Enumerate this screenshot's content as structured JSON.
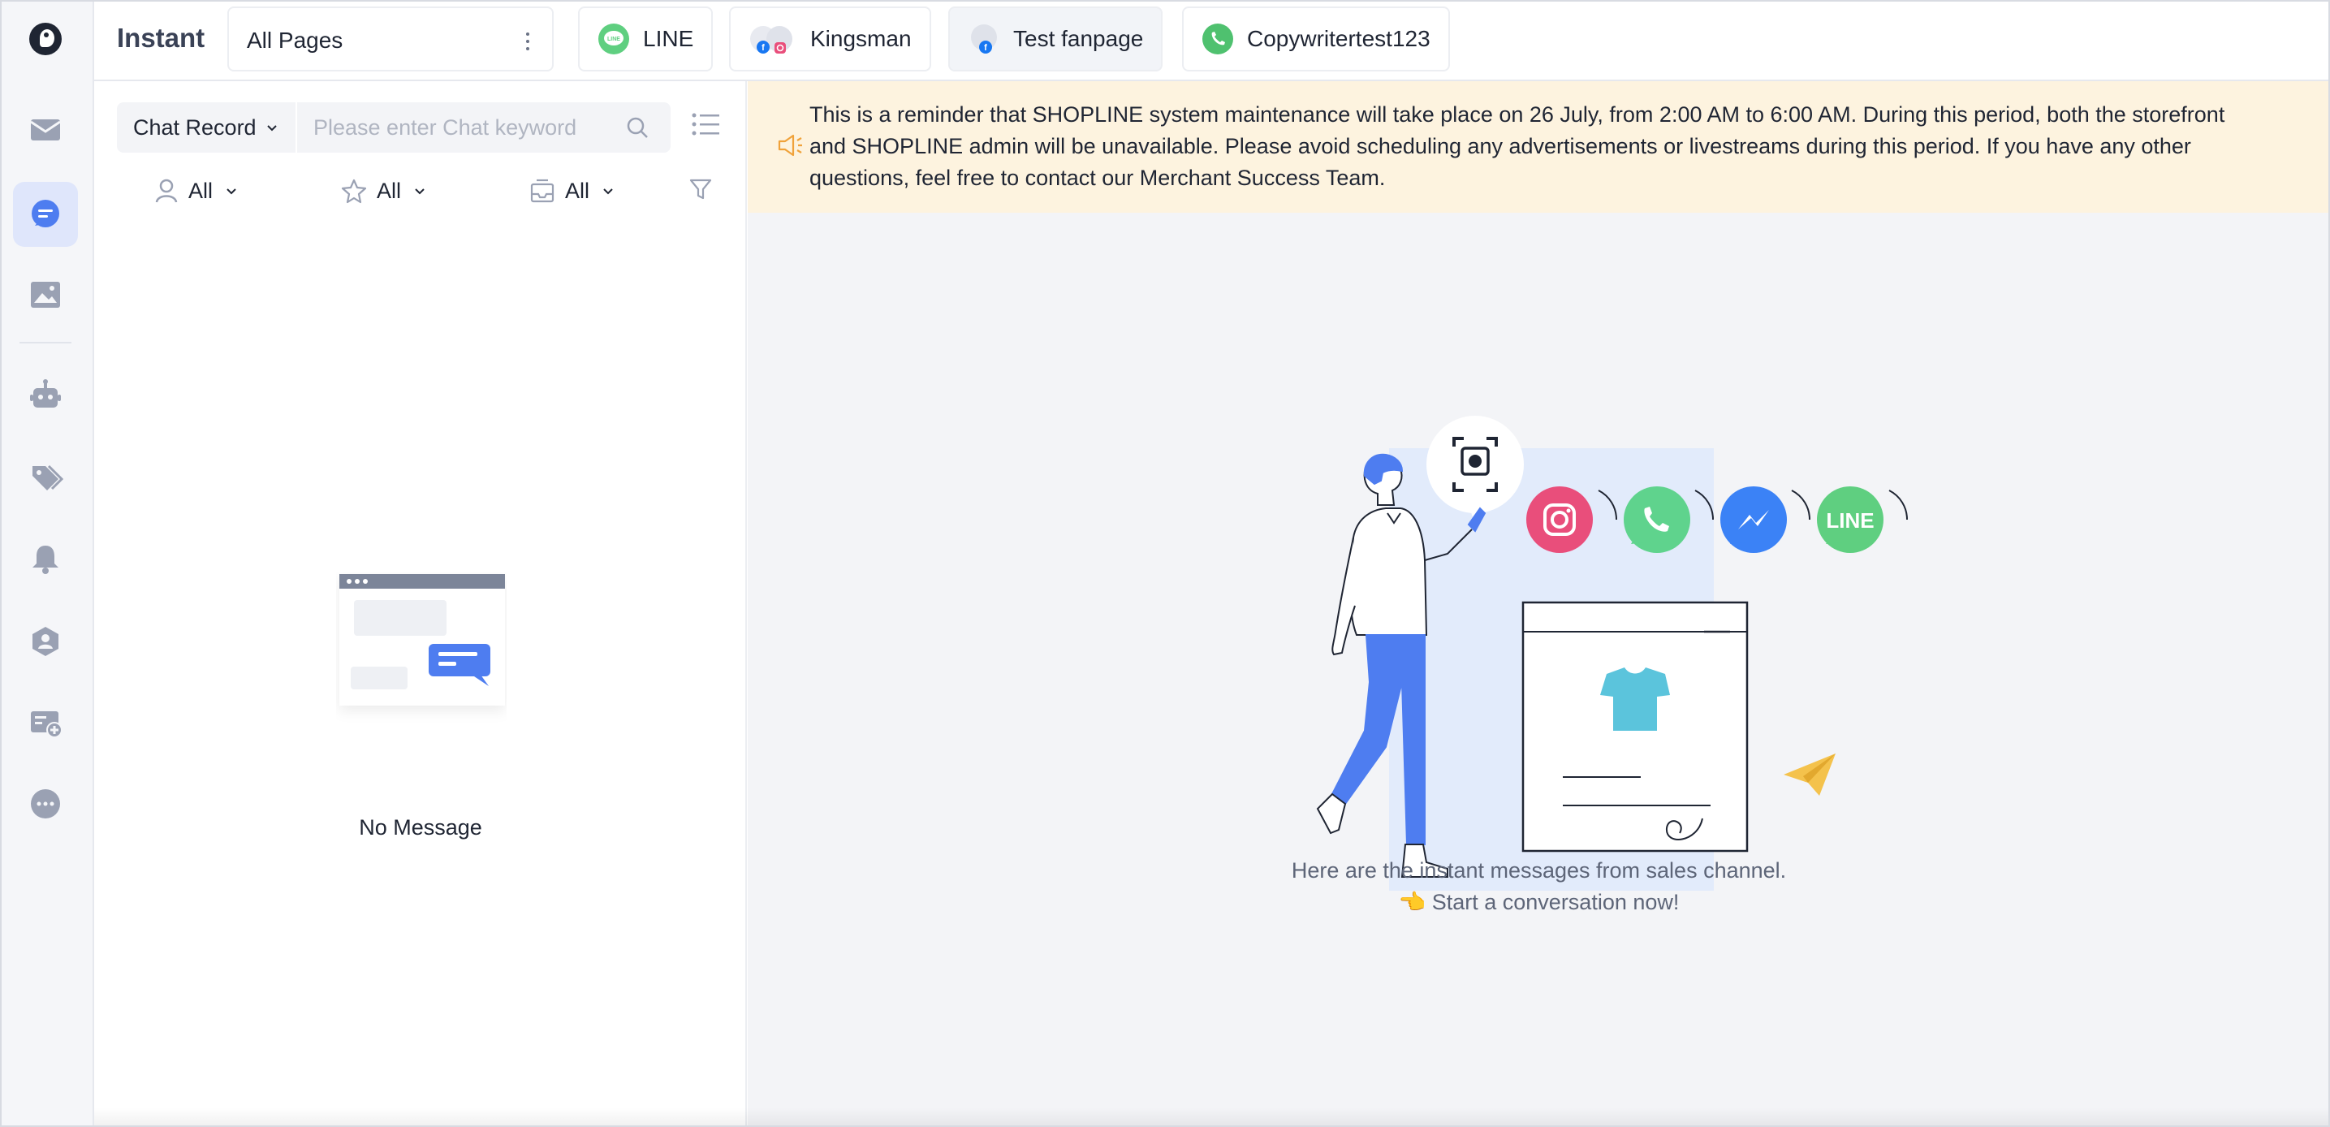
{
  "app": {
    "title": "Instant"
  },
  "page_selector": {
    "label": "All Pages"
  },
  "channel_tabs": [
    {
      "label": "LINE",
      "icon": "line-icon"
    },
    {
      "label": "Kingsman",
      "icon": "facebook-instagram-avatar-icon"
    },
    {
      "label": "Test fanpage",
      "icon": "facebook-avatar-icon"
    },
    {
      "label": "Copywritertest123",
      "icon": "whatsapp-icon"
    }
  ],
  "sidebar": {
    "items": [
      {
        "name": "inbox-icon"
      },
      {
        "name": "chat-icon",
        "active": true
      },
      {
        "name": "image-icon"
      },
      {
        "name": "bot-icon"
      },
      {
        "name": "tags-icon"
      },
      {
        "name": "bell-icon"
      },
      {
        "name": "team-icon"
      },
      {
        "name": "broadcast-icon"
      },
      {
        "name": "more-icon"
      }
    ]
  },
  "search": {
    "scope_label": "Chat Record",
    "placeholder": "Please enter Chat keyword"
  },
  "filters": {
    "assignee": "All",
    "star": "All",
    "inbox": "All"
  },
  "empty_state": {
    "text": "No Message"
  },
  "banner": {
    "text": "This is a reminder that SHOPLINE system maintenance will take place on 26 July, from 2:00 AM to 6:00 AM. During this period, both the storefront and SHOPLINE admin will be unavailable. Please avoid scheduling any advertisements or livestreams during this period. If you have any other questions, feel free to contact our Merchant Success Team."
  },
  "hero": {
    "line1": "Here are the instant messages from sales channel.",
    "line2": "👈 Start a conversation now!",
    "line2_display": "☜ Start a conversation now!",
    "channel_badges": [
      "instagram-icon",
      "whatsapp-icon",
      "messenger-icon",
      "line-icon"
    ],
    "badge_line_text": "LINE"
  },
  "colors": {
    "accent": "#4e7df0",
    "banner_bg": "#fdf3df",
    "instagram": "#e94e7b",
    "whatsapp": "#5fd38d",
    "messenger": "#3b82f6",
    "line": "#5fcf80"
  }
}
